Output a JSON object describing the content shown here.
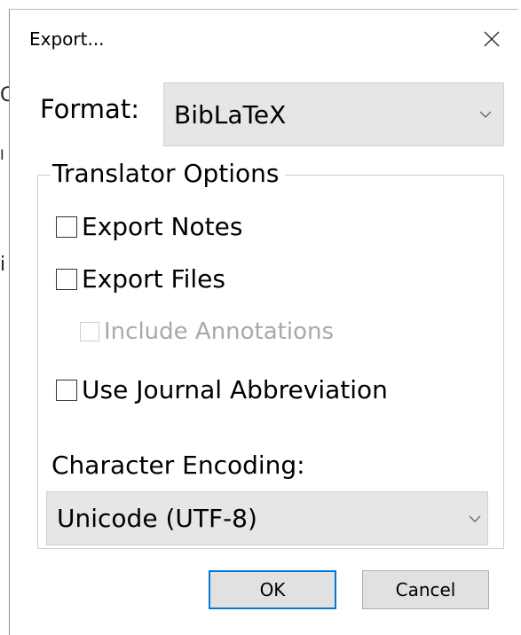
{
  "dialog": {
    "title": "Export...",
    "close_icon": "close-icon"
  },
  "format": {
    "label": "Format:",
    "selected": "BibLaTeX"
  },
  "translator_options": {
    "legend": "Translator Options",
    "options": [
      {
        "label": "Export Notes",
        "checked": false,
        "enabled": true
      },
      {
        "label": "Export Files",
        "checked": false,
        "enabled": true
      },
      {
        "label": "Include Annotations",
        "checked": false,
        "enabled": false
      },
      {
        "label": "Use Journal Abbreviation",
        "checked": false,
        "enabled": true
      }
    ]
  },
  "encoding": {
    "label": "Character Encoding:",
    "selected": "Unicode (UTF-8)"
  },
  "buttons": {
    "ok": "OK",
    "cancel": "Cancel"
  },
  "colors": {
    "default_button_border": "#0078d7",
    "select_bg": "#e6e6e6",
    "disabled_text": "#a9a9a9"
  }
}
